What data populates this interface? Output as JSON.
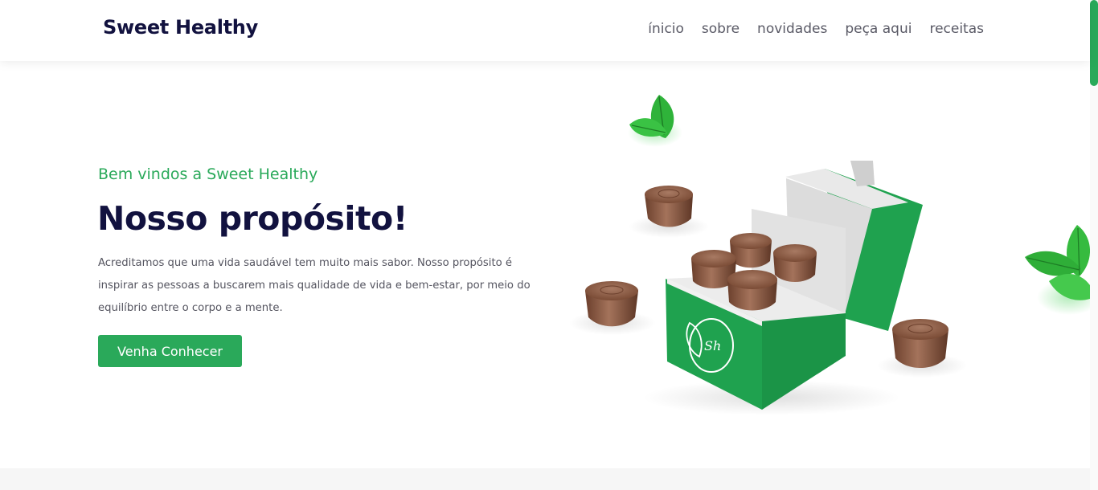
{
  "header": {
    "brand": "Sweet Healthy",
    "nav": [
      {
        "label": "ínicio"
      },
      {
        "label": "sobre"
      },
      {
        "label": "novidades"
      },
      {
        "label": "peça aqui"
      },
      {
        "label": "receitas"
      }
    ]
  },
  "hero": {
    "subtitle": "Bem vindos a Sweet Healthy",
    "title": "Nosso propósito!",
    "description": "Acreditamos que uma vida saudável tem muito mais sabor. Nosso propósito é inspirar as pessoas a buscarem mais qualidade de vida e bem-estar, por meio do equilíbrio entre o corpo e a mente.",
    "cta_label": "Venha Conhecer",
    "image": {
      "box_logo_text": "Sh"
    }
  },
  "colors": {
    "accent": "#2aa95a",
    "heading": "#12123f",
    "body_text": "#555560",
    "chocolate": "#8a5a44",
    "box_green": "#1fa24f"
  },
  "icons": [
    "mint-leaf-icon",
    "chocolate-bonbon",
    "gift-box"
  ]
}
